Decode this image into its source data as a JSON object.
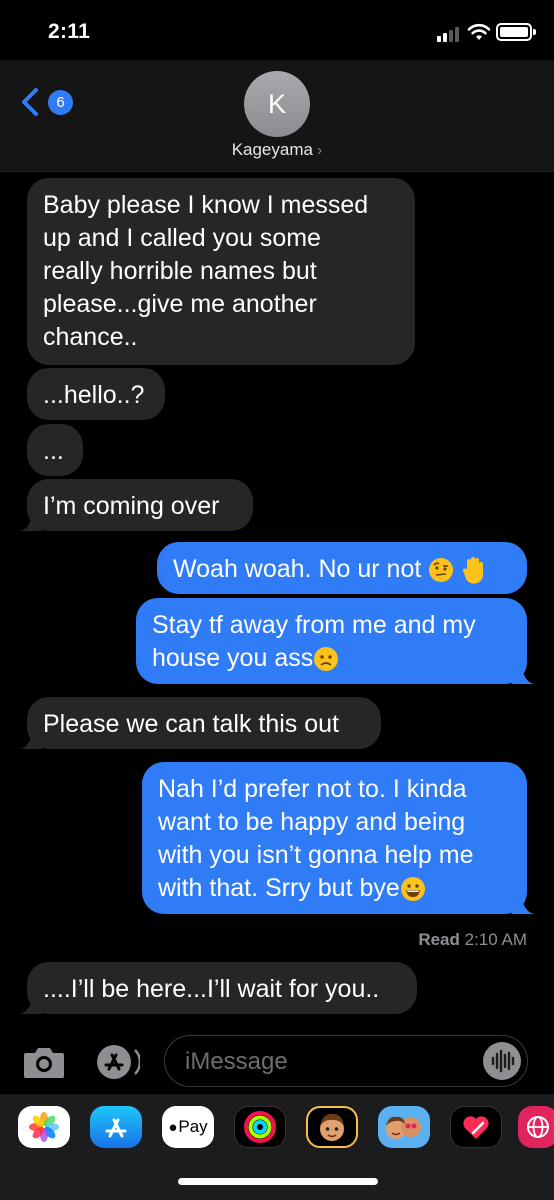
{
  "status_bar": {
    "time": "2:11"
  },
  "header": {
    "back_badge": "6",
    "avatar_initial": "K",
    "contact_name": "Kageyama",
    "contact_chevron": "›"
  },
  "messages": [
    {
      "from": "them",
      "lines": [
        "Baby please I know I messed",
        "up and I called you some",
        "really horrible names but",
        "please...give me another",
        "chance.."
      ]
    },
    {
      "from": "them",
      "lines": [
        "...hello..?"
      ]
    },
    {
      "from": "them",
      "lines": [
        "..."
      ]
    },
    {
      "from": "them",
      "lines": [
        "I’m coming over"
      ]
    },
    {
      "from": "me",
      "lines": [
        "Woah woah. No ur not"
      ],
      "emoji": [
        "face-with-raised-eyebrow",
        "raised-hand"
      ]
    },
    {
      "from": "me",
      "lines": [
        "Stay tf away from me and my",
        "house you ass"
      ],
      "emoji": [
        "worried-face"
      ]
    },
    {
      "from": "them",
      "lines": [
        "Please we can talk this out"
      ]
    },
    {
      "from": "me",
      "lines": [
        "Nah I’d prefer not to. I kinda",
        "want to be happy and being",
        "with you isn’t gonna help me",
        "with that. Srry but bye"
      ],
      "emoji": [
        "grinning-face"
      ]
    },
    {
      "from": "them",
      "lines": [
        "....I’ll be here...I’ll wait for you.."
      ]
    }
  ],
  "read_receipt": {
    "label": "Read",
    "time": "2:10 AM"
  },
  "input_bar": {
    "placeholder": "iMessage"
  },
  "app_drawer": {
    "apps": [
      {
        "name": "photos-icon"
      },
      {
        "name": "app-store-icon"
      },
      {
        "name": "apple-pay-icon",
        "label": "Pay"
      },
      {
        "name": "activity-icon"
      },
      {
        "name": "memoji-icon"
      },
      {
        "name": "memoji-stickers-icon"
      },
      {
        "name": "memoji-hearts-icon"
      },
      {
        "name": "digital-touch-icon"
      },
      {
        "name": "web-search-icon"
      }
    ]
  },
  "colors": {
    "outgoing_bubble": "#2f7cf6",
    "incoming_bubble": "#262628",
    "background": "#000000",
    "header": "#151515"
  }
}
